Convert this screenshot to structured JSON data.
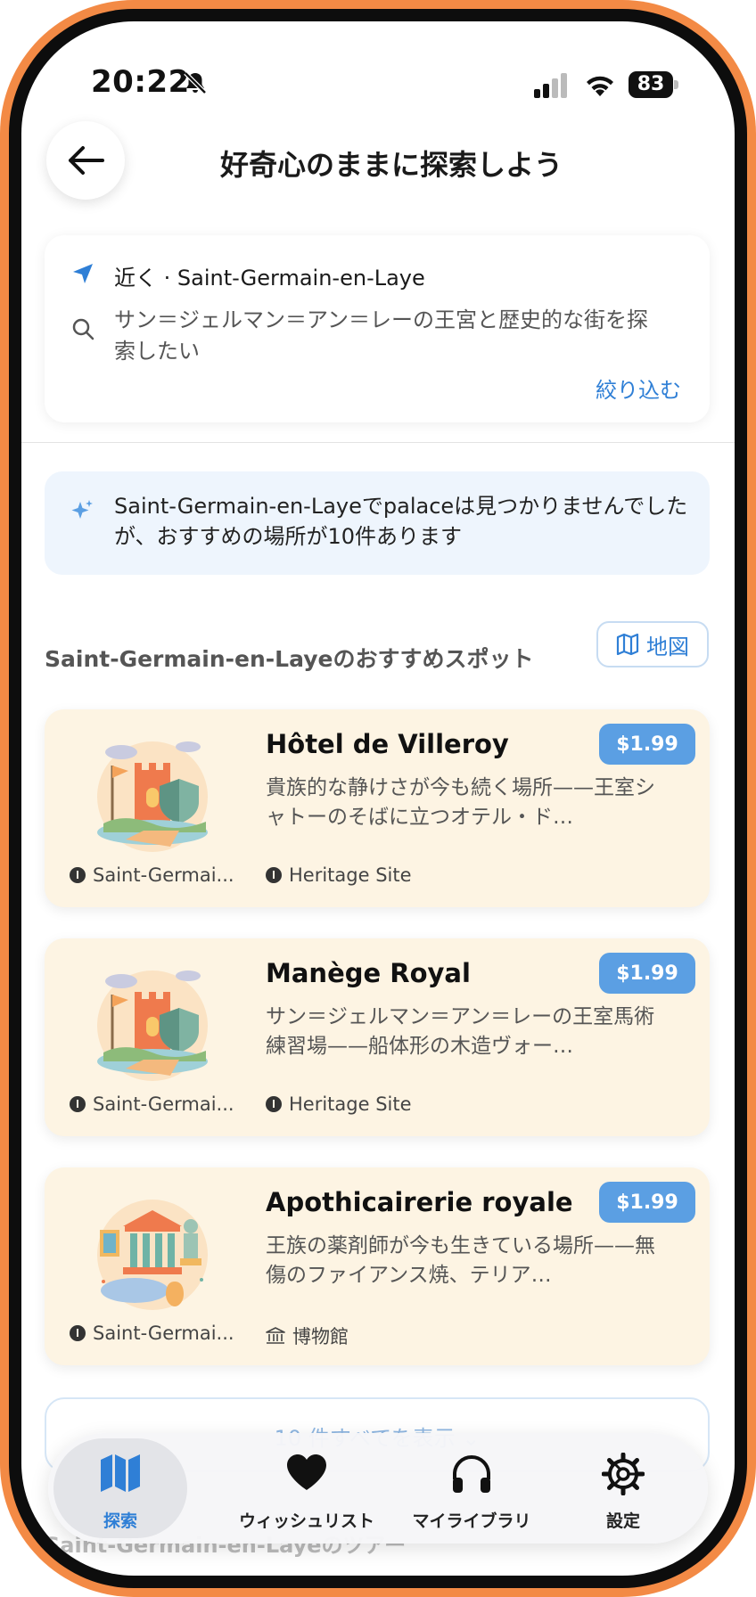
{
  "status_bar": {
    "time": "20:22",
    "battery": "83"
  },
  "header": {
    "title": "好奇心のままに探索しよう"
  },
  "search": {
    "location": "近く · Saint-Germain-en-Laye",
    "query": "サン＝ジェルマン＝アン＝レーの王宮と歴史的な街を探索したい",
    "refine_label": "絞り込む"
  },
  "banner": {
    "text": "Saint-Germain-en-Layeでpalaceは見つかりませんでしたが、おすすめの場所が10件あります"
  },
  "section": {
    "title": "Saint-Germain-en-Layeのおすすめスポット",
    "map_label": "地図"
  },
  "places": [
    {
      "name": "Hôtel de Villeroy",
      "description": "貴族的な静けさが今も続く場所——王室シャトーのそばに立つオテル・ド…",
      "price": "$1.99",
      "location": "Saint-Germai...",
      "category": "Heritage Site",
      "category_icon": "info-icon"
    },
    {
      "name": "Manège Royal",
      "description": "サン＝ジェルマン＝アン＝レーの王室馬術練習場——船体形の木造ヴォー…",
      "price": "$1.99",
      "location": "Saint-Germai...",
      "category": "Heritage Site",
      "category_icon": "info-icon"
    },
    {
      "name": "Apothicairerie royale",
      "description": "王族の薬剤師が今も生きている場所——無傷のファイアンス焼、テリア…",
      "price": "$1.99",
      "location": "Saint-Germai...",
      "category": "博物館",
      "category_icon": "museum-icon"
    }
  ],
  "show_all_label": "10 件すべてを表示 ⌄",
  "tours_title": "Saint-Germain-en-Layeのツアー",
  "tabs": [
    {
      "label": "探索",
      "icon": "map-icon",
      "active": true
    },
    {
      "label": "ウィッシュリスト",
      "icon": "heart-icon",
      "active": false
    },
    {
      "label": "マイライブラリ",
      "icon": "headphones-icon",
      "active": false
    },
    {
      "label": "設定",
      "icon": "gear-icon",
      "active": false
    }
  ],
  "colors": {
    "accent": "#2f7fd6",
    "card_bg": "#fdf4e3",
    "price_badge": "#5b9fe3",
    "frame": "#f38a45"
  }
}
